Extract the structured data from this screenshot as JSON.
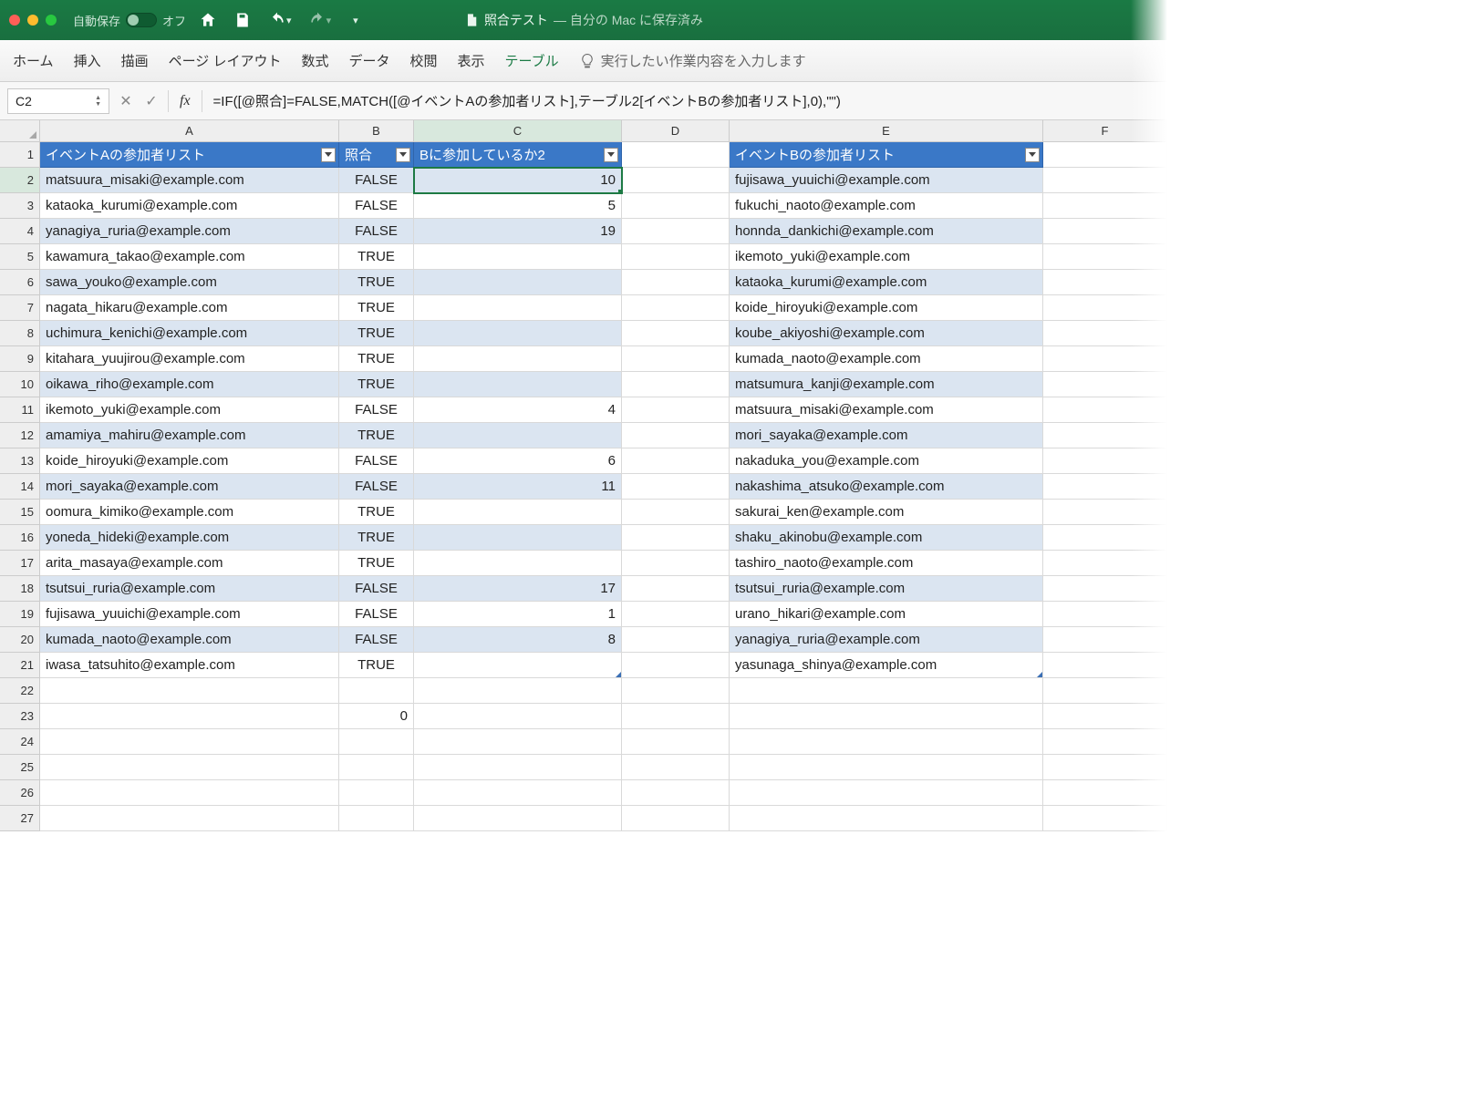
{
  "titlebar": {
    "autosave_label": "自動保存",
    "autosave_state": "オフ",
    "doc_name": "照合テスト",
    "doc_status": " — 自分の Mac に保存済み"
  },
  "ribbon": {
    "tabs": [
      "ホーム",
      "挿入",
      "描画",
      "ページ レイアウト",
      "数式",
      "データ",
      "校閲",
      "表示",
      "テーブル"
    ],
    "active_index": 8,
    "tell_me": "実行したい作業内容を入力します"
  },
  "formula_bar": {
    "name_box": "C2",
    "formula": "=IF([@照合]=FALSE,MATCH([@イベントAの参加者リスト],テーブル2[イベントBの参加者リスト],0),\"\")"
  },
  "columns": [
    "A",
    "B",
    "C",
    "D",
    "E",
    "F"
  ],
  "headers": {
    "A": "イベントAの参加者リスト",
    "B": "照合",
    "C": "Bに参加しているか2",
    "E": "イベントBの参加者リスト"
  },
  "rows": [
    {
      "n": 1
    },
    {
      "n": 2,
      "A": "matsuura_misaki@example.com",
      "B": "FALSE",
      "C": "10",
      "E": "fujisawa_yuuichi@example.com"
    },
    {
      "n": 3,
      "A": "kataoka_kurumi@example.com",
      "B": "FALSE",
      "C": "5",
      "E": "fukuchi_naoto@example.com"
    },
    {
      "n": 4,
      "A": "yanagiya_ruria@example.com",
      "B": "FALSE",
      "C": "19",
      "E": "honnda_dankichi@example.com"
    },
    {
      "n": 5,
      "A": "kawamura_takao@example.com",
      "B": "TRUE",
      "C": "",
      "E": "ikemoto_yuki@example.com"
    },
    {
      "n": 6,
      "A": "sawa_youko@example.com",
      "B": "TRUE",
      "C": "",
      "E": "kataoka_kurumi@example.com"
    },
    {
      "n": 7,
      "A": "nagata_hikaru@example.com",
      "B": "TRUE",
      "C": "",
      "E": "koide_hiroyuki@example.com"
    },
    {
      "n": 8,
      "A": "uchimura_kenichi@example.com",
      "B": "TRUE",
      "C": "",
      "E": "koube_akiyoshi@example.com"
    },
    {
      "n": 9,
      "A": "kitahara_yuujirou@example.com",
      "B": "TRUE",
      "C": "",
      "E": "kumada_naoto@example.com"
    },
    {
      "n": 10,
      "A": "oikawa_riho@example.com",
      "B": "TRUE",
      "C": "",
      "E": "matsumura_kanji@example.com"
    },
    {
      "n": 11,
      "A": "ikemoto_yuki@example.com",
      "B": "FALSE",
      "C": "4",
      "E": "matsuura_misaki@example.com"
    },
    {
      "n": 12,
      "A": "amamiya_mahiru@example.com",
      "B": "TRUE",
      "C": "",
      "E": "mori_sayaka@example.com"
    },
    {
      "n": 13,
      "A": "koide_hiroyuki@example.com",
      "B": "FALSE",
      "C": "6",
      "E": "nakaduka_you@example.com"
    },
    {
      "n": 14,
      "A": "mori_sayaka@example.com",
      "B": "FALSE",
      "C": "11",
      "E": "nakashima_atsuko@example.com"
    },
    {
      "n": 15,
      "A": "oomura_kimiko@example.com",
      "B": "TRUE",
      "C": "",
      "E": "sakurai_ken@example.com"
    },
    {
      "n": 16,
      "A": "yoneda_hideki@example.com",
      "B": "TRUE",
      "C": "",
      "E": "shaku_akinobu@example.com"
    },
    {
      "n": 17,
      "A": "arita_masaya@example.com",
      "B": "TRUE",
      "C": "",
      "E": "tashiro_naoto@example.com"
    },
    {
      "n": 18,
      "A": "tsutsui_ruria@example.com",
      "B": "FALSE",
      "C": "17",
      "E": "tsutsui_ruria@example.com"
    },
    {
      "n": 19,
      "A": "fujisawa_yuuichi@example.com",
      "B": "FALSE",
      "C": "1",
      "E": "urano_hikari@example.com"
    },
    {
      "n": 20,
      "A": "kumada_naoto@example.com",
      "B": "FALSE",
      "C": "8",
      "E": "yanagiya_ruria@example.com"
    },
    {
      "n": 21,
      "A": "iwasa_tatsuhito@example.com",
      "B": "TRUE",
      "C": "",
      "E": "yasunaga_shinya@example.com"
    },
    {
      "n": 22
    },
    {
      "n": 23,
      "B": "0"
    },
    {
      "n": 24
    },
    {
      "n": 25
    },
    {
      "n": 26
    },
    {
      "n": 27
    }
  ]
}
